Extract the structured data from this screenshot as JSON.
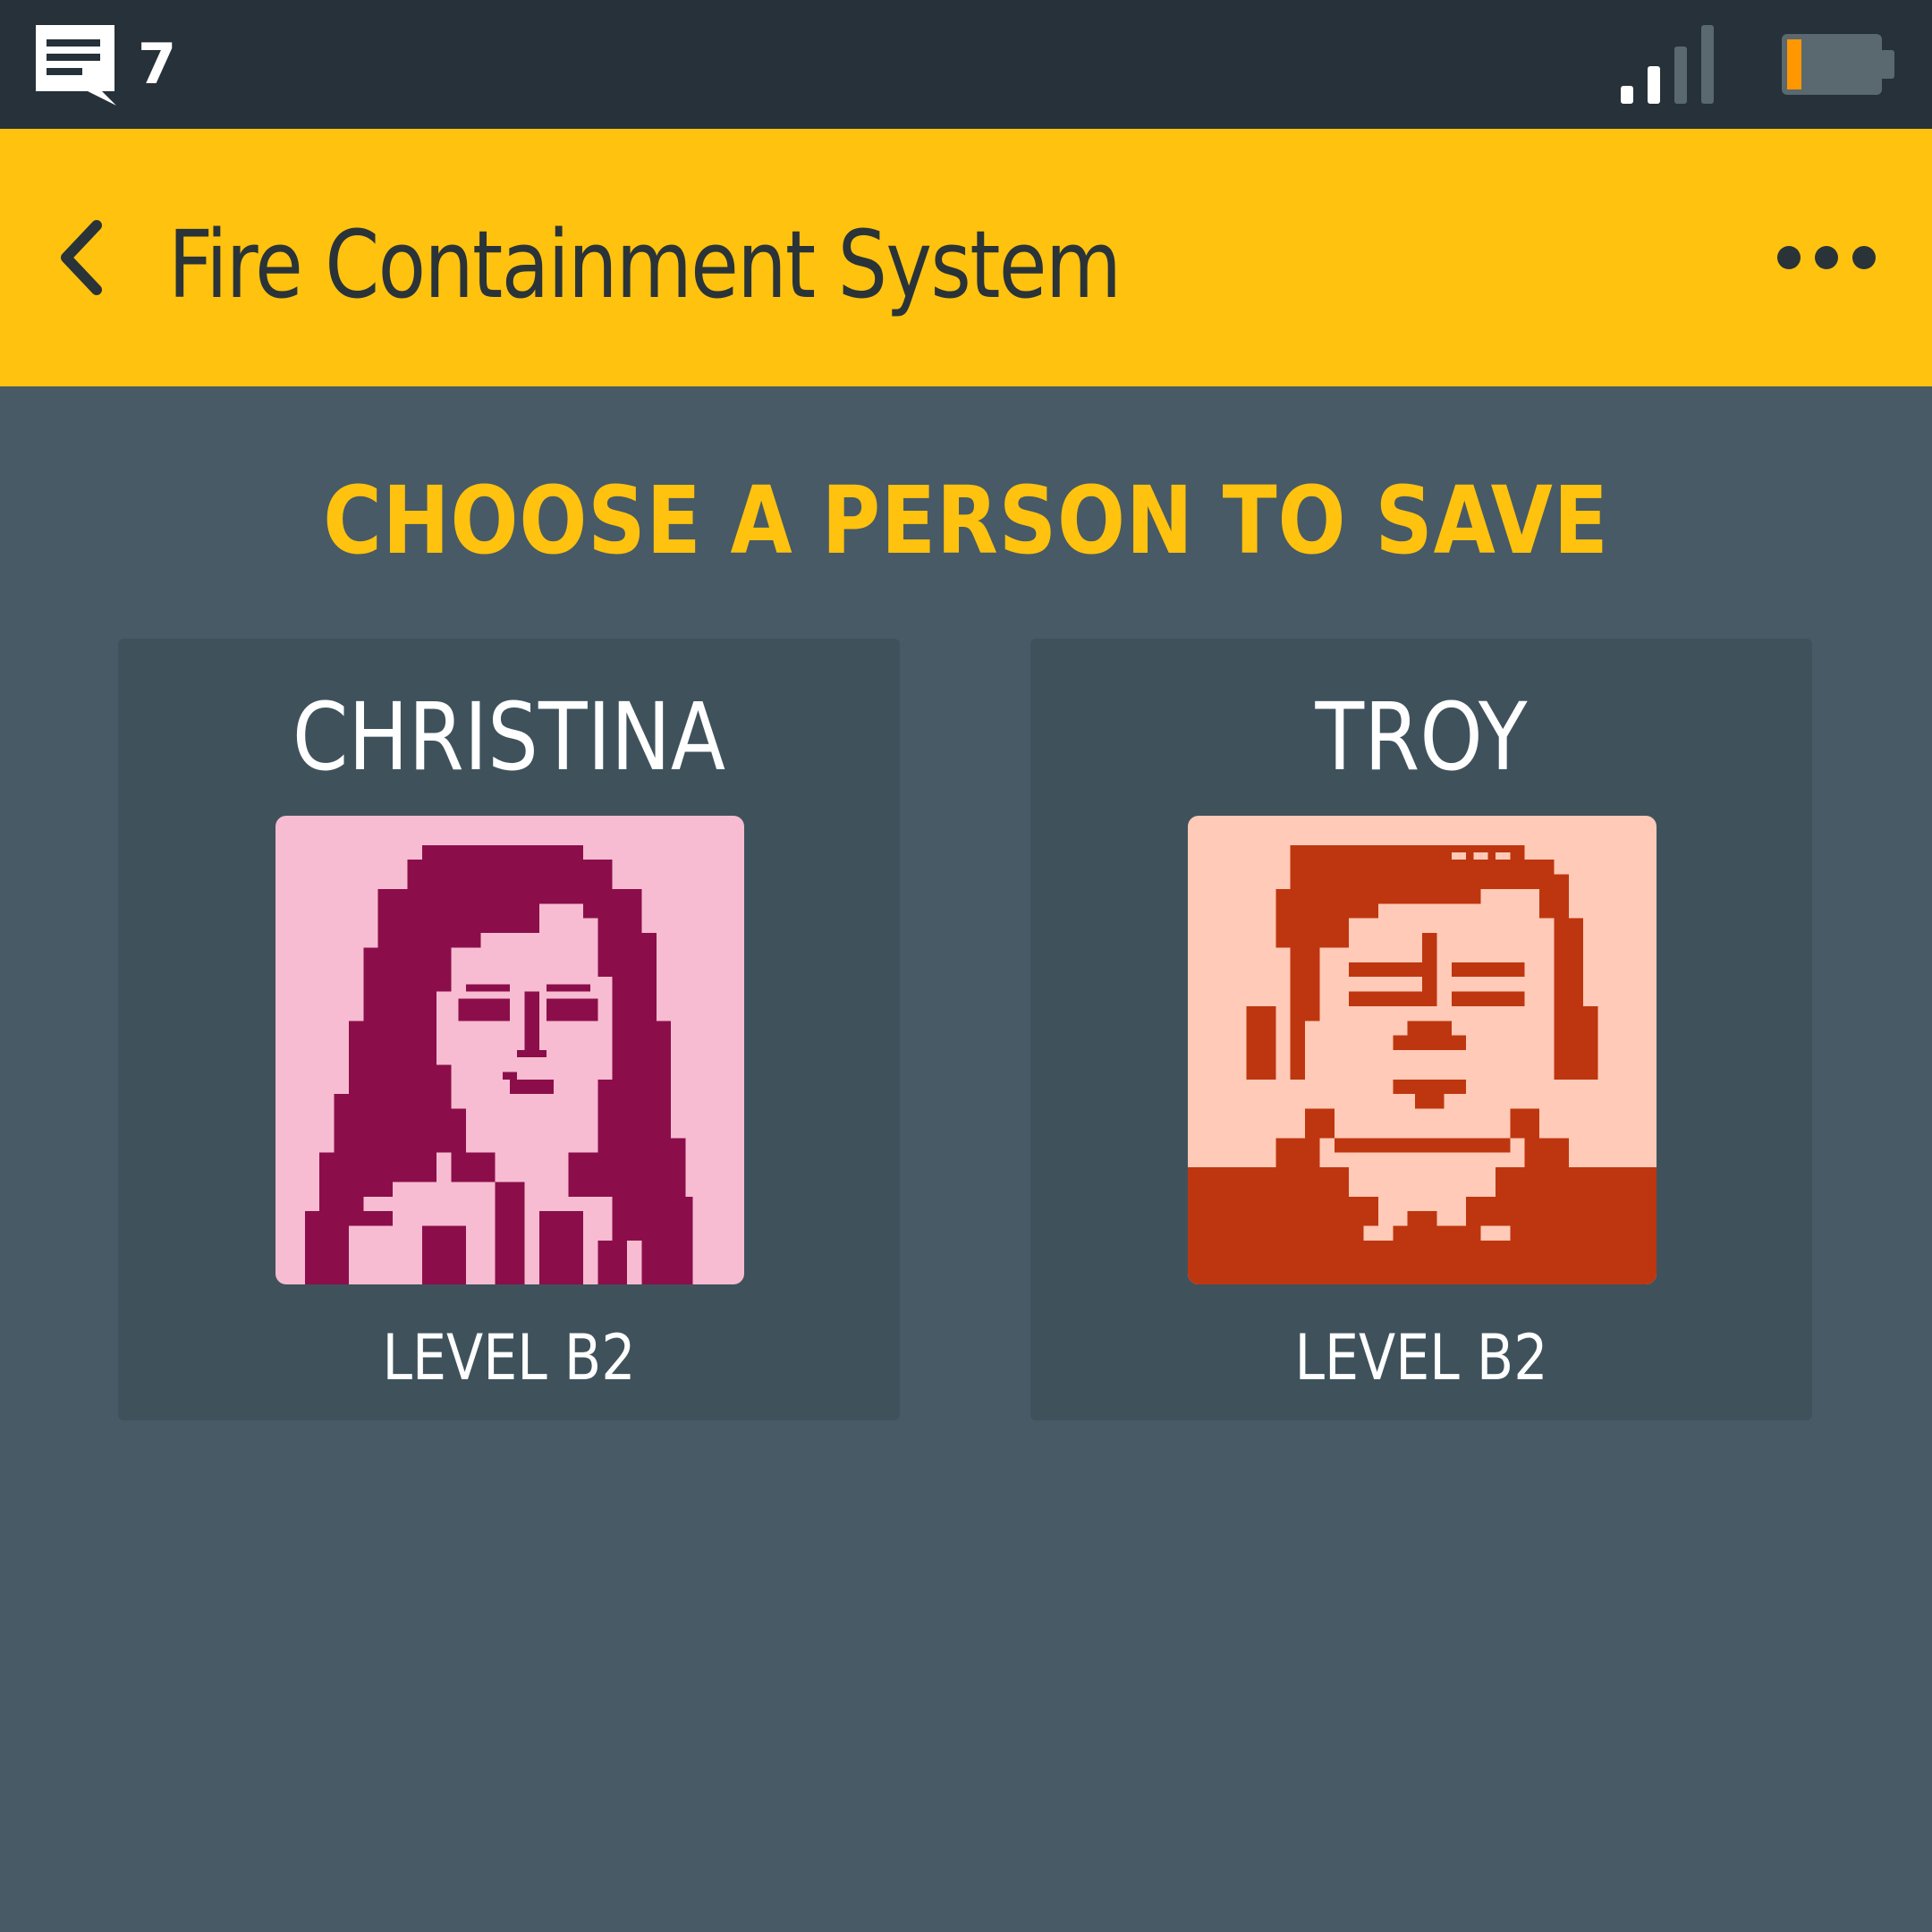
{
  "status_bar": {
    "message_count": "7",
    "icons": [
      "message-icon",
      "signal-icon",
      "battery-low-icon"
    ],
    "signal_bars_active": 2,
    "signal_bars_total": 4,
    "battery_level": 0.15
  },
  "app_bar": {
    "title": "Fire Containment System",
    "back_icon": "chevron-left-icon",
    "menu_icon": "more-horizontal-icon"
  },
  "main": {
    "heading": "CHOOSE A PERSON TO SAVE",
    "people": [
      {
        "name": "CHRISTINA",
        "level": "LEVEL B2",
        "portrait_bg": "#f7bcd1",
        "portrait_fg": "#8b0e4a"
      },
      {
        "name": "TROY",
        "level": "LEVEL B2",
        "portrait_bg": "#ffcab7",
        "portrait_fg": "#be360f"
      }
    ]
  },
  "colors": {
    "status_bar": "#263139",
    "app_bar": "#ffc20e",
    "background": "#475a66",
    "card": "#3f525c",
    "accent": "#ffc20e",
    "battery_fill": "#ff9800"
  }
}
